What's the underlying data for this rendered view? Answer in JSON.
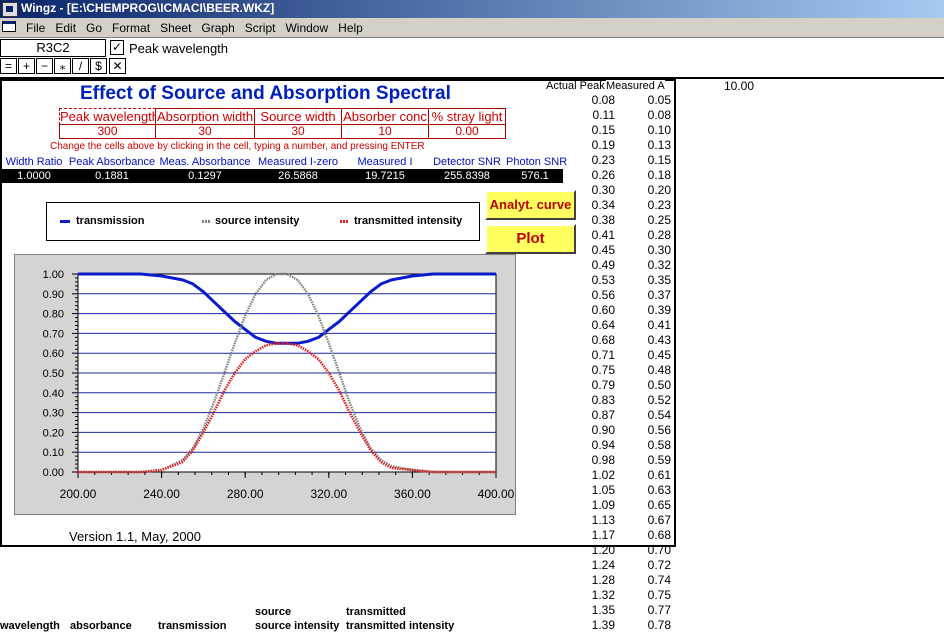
{
  "window": {
    "title": "Wingz - [E:\\CHEMPROG\\ICMACI\\BEER.WKZ]"
  },
  "menu": [
    "File",
    "Edit",
    "Go",
    "Format",
    "Sheet",
    "Graph",
    "Script",
    "Window",
    "Help"
  ],
  "formula_bar": {
    "cell_ref": "R3C2",
    "check": "✓",
    "content": "Peak wavelength"
  },
  "toolbar": [
    "=",
    "+",
    "−",
    "⁎",
    "/",
    "$",
    "✕"
  ],
  "sheet": {
    "title": "Effect of Source and Absorption Spectral",
    "params": [
      {
        "label": "Peak wavelength",
        "value": "300"
      },
      {
        "label": "Absorption width",
        "value": "30"
      },
      {
        "label": "Source width",
        "value": "30"
      },
      {
        "label": "Absorber conc",
        "value": "10"
      },
      {
        "label": "% stray light",
        "value": "0.00"
      }
    ],
    "instruction": "Change the cells above by clicking in the cell, typing a number, and pressing ENTER",
    "results": [
      {
        "label": "Width Ratio",
        "value": "1.0000"
      },
      {
        "label": "Peak Absorbance",
        "value": "0.1881"
      },
      {
        "label": "Meas. Absorbance",
        "value": "0.1297"
      },
      {
        "label": "Measured I-zero",
        "value": "26.5868"
      },
      {
        "label": "Measured I",
        "value": "19.7215"
      },
      {
        "label": "Detector SNR",
        "value": "255.8398"
      },
      {
        "label": "Photon SNR",
        "value": "576.1"
      }
    ],
    "buttons": {
      "analyt_curve": "Analyt. curve",
      "plot": "Plot"
    },
    "version": "Version 1.1, May, 2000"
  },
  "colors": {
    "transmission": "#0a1ccc",
    "source": "#808080",
    "transmitted": "#e02020",
    "accent_title": "#0020c0",
    "param_text": "#d00000"
  },
  "chart_data": {
    "type": "line",
    "xlim": [
      200,
      400
    ],
    "ylim": [
      0,
      1
    ],
    "x_ticks": [
      "200.00",
      "240.00",
      "280.00",
      "320.00",
      "360.00",
      "400.00"
    ],
    "y_ticks": [
      "1.00",
      "0.90",
      "0.80",
      "0.70",
      "0.60",
      "0.50",
      "0.40",
      "0.30",
      "0.20",
      "0.10",
      "0.00"
    ],
    "grid": true,
    "legend_position": "top",
    "x": [
      200,
      210,
      220,
      230,
      240,
      250,
      255,
      260,
      265,
      270,
      275,
      280,
      285,
      290,
      295,
      300,
      305,
      310,
      315,
      320,
      325,
      330,
      335,
      340,
      345,
      350,
      360,
      370,
      380,
      390,
      400
    ],
    "series": [
      {
        "name": "transmission",
        "values": [
          1.0,
          1.0,
          1.0,
          1.0,
          0.99,
          0.97,
          0.95,
          0.91,
          0.86,
          0.81,
          0.76,
          0.72,
          0.68,
          0.66,
          0.65,
          0.65,
          0.65,
          0.66,
          0.68,
          0.72,
          0.76,
          0.81,
          0.86,
          0.91,
          0.95,
          0.97,
          0.99,
          1.0,
          1.0,
          1.0,
          1.0
        ]
      },
      {
        "name": "source intensity",
        "values": [
          0.0,
          0.0,
          0.0,
          0.0,
          0.01,
          0.06,
          0.12,
          0.22,
          0.35,
          0.5,
          0.65,
          0.79,
          0.9,
          0.97,
          1.0,
          1.0,
          0.97,
          0.9,
          0.79,
          0.65,
          0.5,
          0.35,
          0.22,
          0.12,
          0.06,
          0.03,
          0.01,
          0.0,
          0.0,
          0.0,
          0.0
        ]
      },
      {
        "name": "transmitted intensity",
        "values": [
          0.0,
          0.0,
          0.0,
          0.0,
          0.01,
          0.05,
          0.11,
          0.2,
          0.3,
          0.41,
          0.5,
          0.57,
          0.61,
          0.64,
          0.65,
          0.65,
          0.64,
          0.61,
          0.57,
          0.5,
          0.41,
          0.3,
          0.2,
          0.11,
          0.05,
          0.02,
          0.01,
          0.0,
          0.0,
          0.0,
          0.0
        ]
      }
    ]
  },
  "table": {
    "col_headers": [
      "Actual Peak A",
      "Measured A"
    ],
    "actual": [
      "0.08",
      "0.11",
      "0.15",
      "0.19",
      "0.23",
      "0.26",
      "0.30",
      "0.34",
      "0.38",
      "0.41",
      "0.45",
      "0.49",
      "0.53",
      "0.56",
      "0.60",
      "0.64",
      "0.68",
      "0.71",
      "0.75",
      "0.79",
      "0.83",
      "0.87",
      "0.90",
      "0.94",
      "0.98",
      "1.02",
      "1.05",
      "1.09",
      "1.13",
      "1.17",
      "1.20",
      "1.24",
      "1.28",
      "1.32",
      "1.35",
      "1.39"
    ],
    "measured": [
      "0.05",
      "0.08",
      "0.10",
      "0.13",
      "0.15",
      "0.18",
      "0.20",
      "0.23",
      "0.25",
      "0.28",
      "0.30",
      "0.32",
      "0.35",
      "0.37",
      "0.39",
      "0.41",
      "0.43",
      "0.45",
      "0.48",
      "0.50",
      "0.52",
      "0.54",
      "0.56",
      "0.58",
      "0.59",
      "0.61",
      "0.63",
      "0.65",
      "0.67",
      "0.68",
      "0.70",
      "0.72",
      "0.74",
      "0.75",
      "0.77",
      "0.78"
    ],
    "extra_value": "10.00"
  },
  "bottom_headers": {
    "row1": [
      "source",
      "transmitted"
    ],
    "row2": [
      "wavelength",
      "absorbance",
      "transmission",
      "source intensity",
      "transmitted intensity"
    ]
  }
}
